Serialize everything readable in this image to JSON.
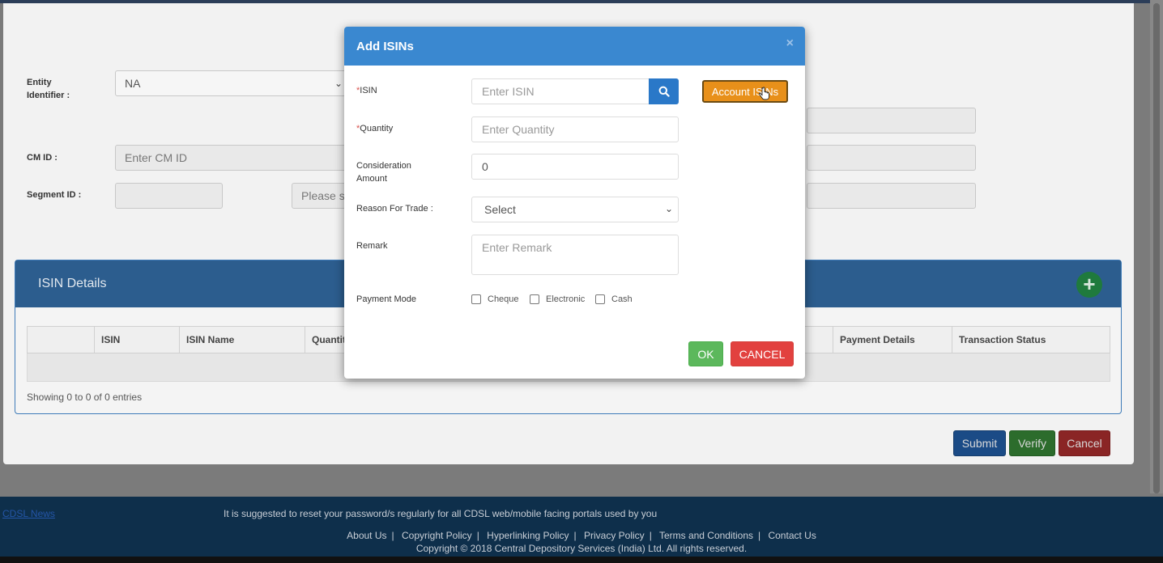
{
  "form": {
    "entity_identifier_label": "Entity Identifier :",
    "entity_identifier_value": "NA",
    "cm_id_label": "CM ID :",
    "cm_id_placeholder": "Enter CM ID",
    "segment_id_label": "Segment ID :",
    "segment_select_placeholder": "Please s"
  },
  "isin_details": {
    "title": "ISIN Details",
    "columns": [
      "",
      "ISIN",
      "ISIN Name",
      "Quantity",
      "Payment Details",
      "Transaction Status"
    ],
    "showing": "Showing 0 to 0 of 0 entries"
  },
  "actions": {
    "submit": "Submit",
    "verify": "Verify",
    "cancel": "Cancel"
  },
  "modal": {
    "title": "Add ISINs",
    "close": "×",
    "isin_label": "ISIN",
    "isin_placeholder": "Enter ISIN",
    "account_isins": "Account ISINs",
    "quantity_label": "Quantity",
    "quantity_placeholder": "Enter Quantity",
    "consideration_label": "Consideration Amount",
    "consideration_value": "0",
    "reason_label": "Reason For Trade :",
    "reason_value": "Select",
    "remark_label": "Remark",
    "remark_placeholder": "Enter Remark",
    "payment_label": "Payment Mode",
    "payment_options": [
      "Cheque",
      "Electronic",
      "Cash"
    ],
    "ok": "OK",
    "cancel": "CANCEL"
  },
  "footer": {
    "news": "CDSL News",
    "ticker": "It is suggested to reset your password/s regularly for all CDSL web/mobile facing portals used by you",
    "links": [
      "About Us",
      "Copyright Policy",
      "Hyperlinking Policy",
      "Privacy Policy",
      "Terms and Conditions",
      "Contact Us"
    ],
    "copyright": "Copyright © 2018 Central Depository Services (India) Ltd. All rights reserved."
  },
  "colors": {
    "modal_header": "#3a88d0",
    "account_isins_button": "#e8901a",
    "ok_button": "#5cb85c",
    "cancel_button": "#e2413f",
    "footer": "#0e2f4b"
  }
}
